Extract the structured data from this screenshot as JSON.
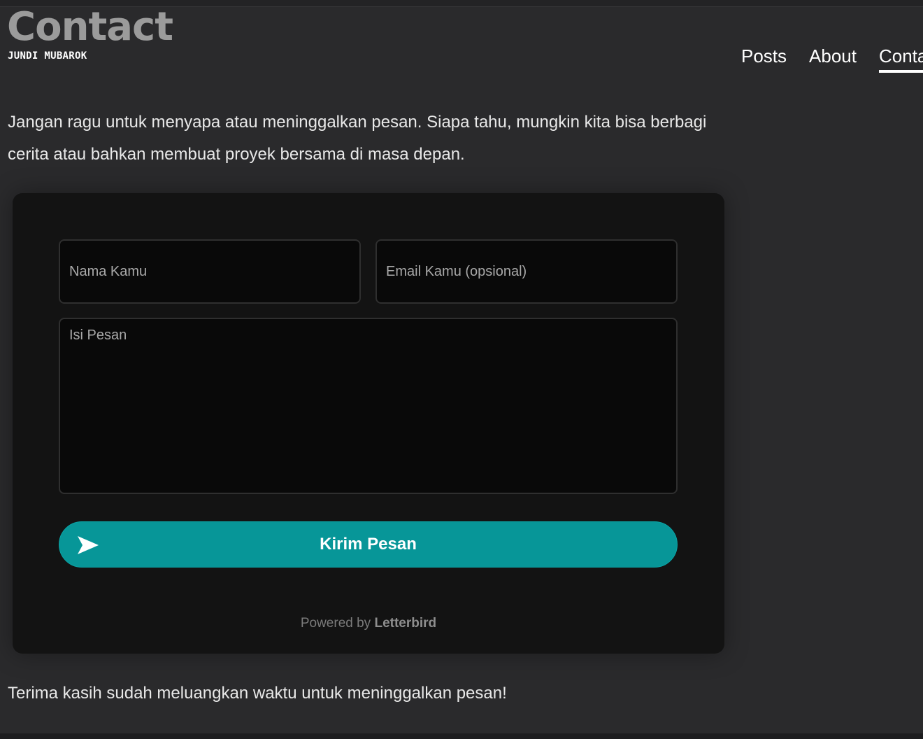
{
  "header": {
    "title": "Contact",
    "subtitle": "JUNDI MUBAROK"
  },
  "nav": {
    "items": [
      {
        "label": "Posts",
        "active": false
      },
      {
        "label": "About",
        "active": false
      },
      {
        "label": "Contact",
        "active": true
      }
    ]
  },
  "content": {
    "intro": "Jangan ragu untuk menyapa atau meninggalkan pesan. Siapa tahu, mungkin kita bisa berbagi cerita atau bahkan membuat proyek bersama di masa depan.",
    "thanks": "Terima kasih sudah meluangkan waktu untuk meninggalkan pesan!"
  },
  "form": {
    "name_placeholder": "Nama Kamu",
    "email_placeholder": "Email Kamu (opsional)",
    "message_placeholder": "Isi Pesan",
    "submit_label": "Kirim Pesan",
    "submit_icon": "send-icon",
    "powered_prefix": "Powered by",
    "powered_brand": "Letterbird"
  },
  "colors": {
    "background": "#2a2a2c",
    "card": "#131313",
    "accent": "#079698"
  }
}
